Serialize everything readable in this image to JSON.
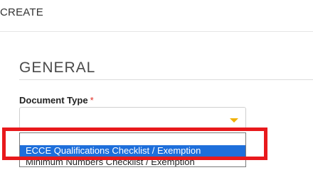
{
  "header": {
    "title": "CREATE"
  },
  "section": {
    "title": "GENERAL"
  },
  "document_type": {
    "label": "Document Type",
    "required_mark": "*",
    "selected_value": "",
    "options": [
      "",
      "ECCE Qualifications Checklist / Exemption",
      "Minimum Numbers Checklist / Exemption"
    ],
    "highlighted_option": "ECCE Qualifications Checklist / Exemption"
  },
  "colors": {
    "accent_arrow": "#f0b000",
    "selection_blue": "#1e6fdb",
    "annotation_red": "#e8191c",
    "required_red": "#e0281e"
  },
  "icons": {
    "select_arrow": "chevron-down-icon"
  }
}
